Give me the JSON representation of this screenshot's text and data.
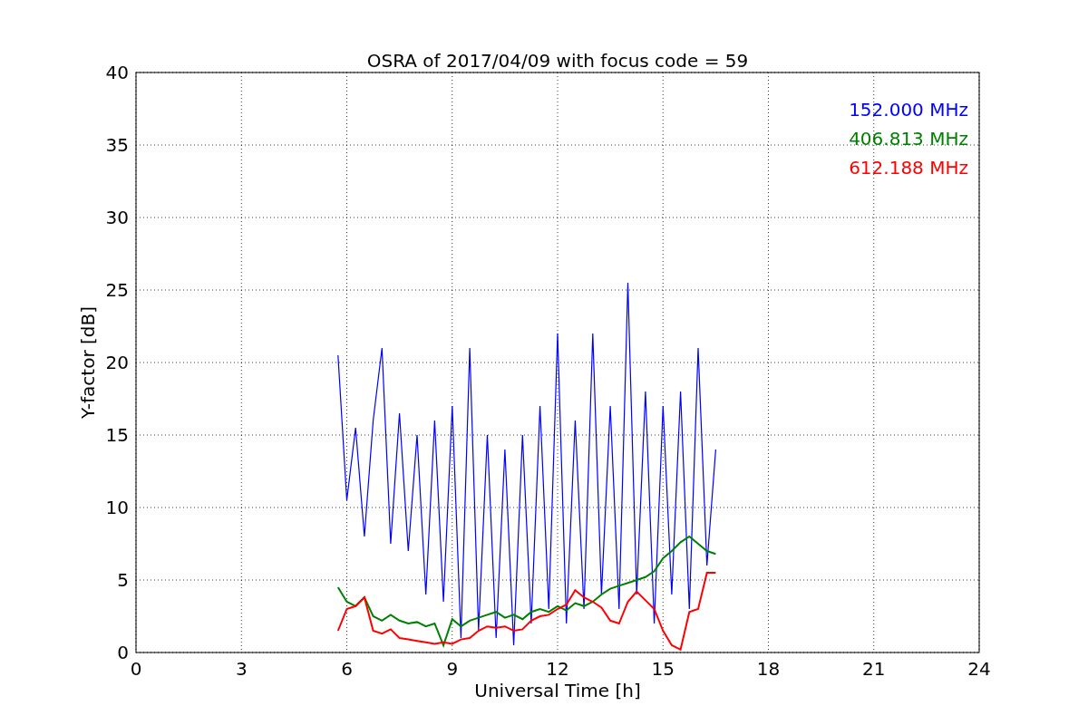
{
  "chart_data": {
    "type": "line",
    "grid": true,
    "title": "OSRA of 2017/04/09 with focus code = 59",
    "xlabel": "Universal Time [h]",
    "ylabel": "Y-factor [dB]",
    "xlim": [
      0,
      24
    ],
    "ylim": [
      0,
      40
    ],
    "xticks": [
      0,
      3,
      6,
      9,
      12,
      15,
      18,
      21,
      24
    ],
    "yticks": [
      0,
      5,
      10,
      15,
      20,
      25,
      30,
      35,
      40
    ],
    "x": [
      5.75,
      6,
      6.25,
      6.5,
      6.75,
      7,
      7.25,
      7.5,
      7.75,
      8,
      8.25,
      8.5,
      8.75,
      9,
      9.25,
      9.5,
      9.75,
      10,
      10.25,
      10.5,
      10.75,
      11,
      11.25,
      11.5,
      11.75,
      12,
      12.25,
      12.5,
      12.75,
      13,
      13.25,
      13.5,
      13.75,
      14,
      14.25,
      14.5,
      14.75,
      15,
      15.25,
      15.5,
      15.75,
      16,
      16.25,
      16.5
    ],
    "series": [
      {
        "name": "152.000 MHz",
        "color": "#0000ff",
        "values": [
          20.5,
          10.5,
          15.5,
          8,
          16,
          21,
          7.5,
          16.5,
          7,
          15,
          4,
          16,
          3.5,
          17,
          1,
          21,
          1.5,
          15,
          1,
          14,
          0.5,
          15,
          2,
          17,
          3,
          22,
          2,
          16,
          3,
          22,
          4,
          17,
          3,
          25.5,
          4,
          18,
          2,
          17,
          4,
          18,
          3,
          21,
          6,
          14
        ]
      },
      {
        "name": "406.813 MHz",
        "color": "#008000",
        "values": [
          4.5,
          3.5,
          3.2,
          3.8,
          2.5,
          2.2,
          2.6,
          2.2,
          2,
          2.1,
          1.8,
          2,
          0.5,
          2.3,
          1.8,
          2.2,
          2.4,
          2.6,
          2.8,
          2.4,
          2.6,
          2.3,
          2.8,
          3,
          2.8,
          3.2,
          2.9,
          3.4,
          3.2,
          3.5,
          4,
          4.4,
          4.6,
          4.8,
          5,
          5.2,
          5.6,
          6.5,
          7,
          7.6,
          8,
          7.5,
          7,
          6.8
        ]
      },
      {
        "name": "612.188 MHz",
        "color": "#ff0000",
        "values": [
          1.5,
          3,
          3.2,
          3.8,
          1.5,
          1.3,
          1.6,
          1,
          0.9,
          0.8,
          0.7,
          0.6,
          0.7,
          0.6,
          0.9,
          1,
          1.5,
          1.8,
          1.7,
          1.8,
          1.5,
          1.6,
          2.2,
          2.5,
          2.6,
          3,
          3.3,
          4.3,
          3.8,
          3.5,
          3.1,
          2.2,
          2,
          3.5,
          4.2,
          3.6,
          3,
          1.5,
          0.5,
          0.2,
          2.8,
          3,
          5.5,
          5.5
        ]
      }
    ]
  }
}
